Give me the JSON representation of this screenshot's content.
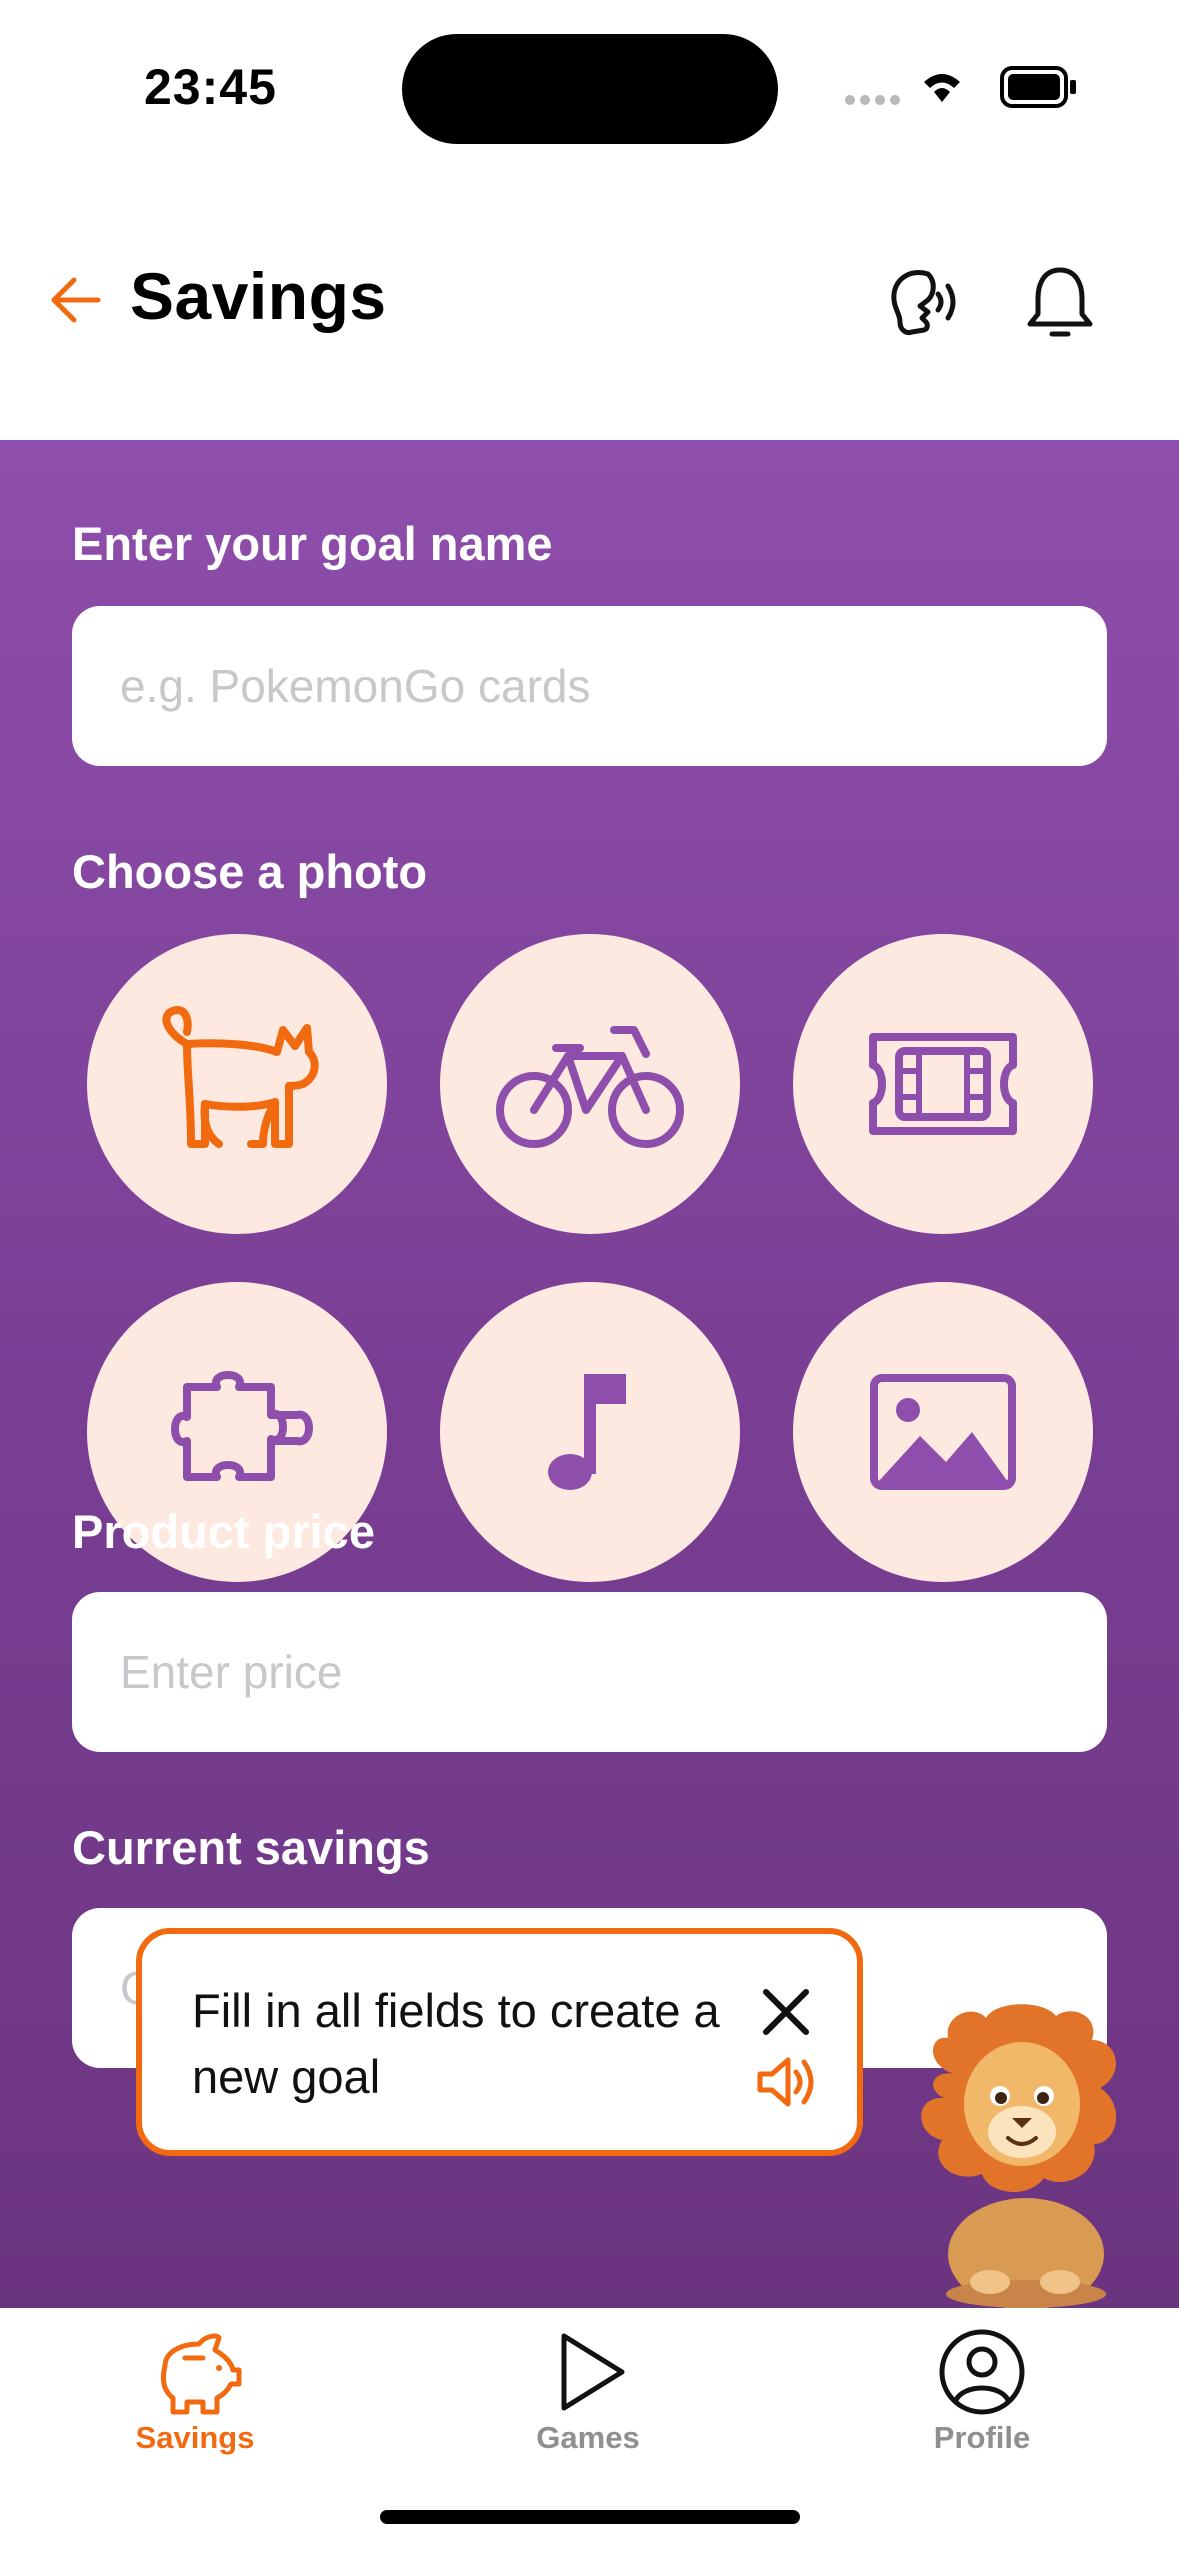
{
  "status_bar": {
    "time": "23:45"
  },
  "header": {
    "title": "Savings",
    "back_icon": "arrow-left-icon",
    "voice_icon": "voice-assistant-icon",
    "bell_icon": "bell-icon"
  },
  "form": {
    "goal_name_label": "Enter your goal name",
    "goal_name_placeholder": "e.g. PokemonGo cards",
    "goal_name_value": "",
    "photo_label": "Choose a photo",
    "photos": [
      {
        "icon": "cat-icon",
        "selected": true
      },
      {
        "icon": "bicycle-icon",
        "selected": false
      },
      {
        "icon": "ticket-icon",
        "selected": false
      },
      {
        "icon": "puzzle-icon",
        "selected": false
      },
      {
        "icon": "music-note-icon",
        "selected": false
      },
      {
        "icon": "image-icon",
        "selected": false
      }
    ],
    "price_label": "Product price",
    "price_placeholder": "Enter price",
    "price_value": "",
    "savings_label": "Current savings",
    "savings_placeholder": "Current savings",
    "savings_value": ""
  },
  "tooltip": {
    "text": "Fill in all fields to create a new goal",
    "close_icon": "close-icon",
    "speaker_icon": "speaker-icon"
  },
  "tabs": [
    {
      "label": "Savings",
      "icon": "piggy-bank-icon",
      "active": true
    },
    {
      "label": "Games",
      "icon": "play-icon",
      "active": false
    },
    {
      "label": "Profile",
      "icon": "profile-icon",
      "active": false
    }
  ],
  "colors": {
    "accent": "#f26a0f",
    "purple": "#8e4eab",
    "circle_bg": "#fde9df",
    "icon_purple": "#8e4eab",
    "inactive_tab": "#8e8e93"
  }
}
